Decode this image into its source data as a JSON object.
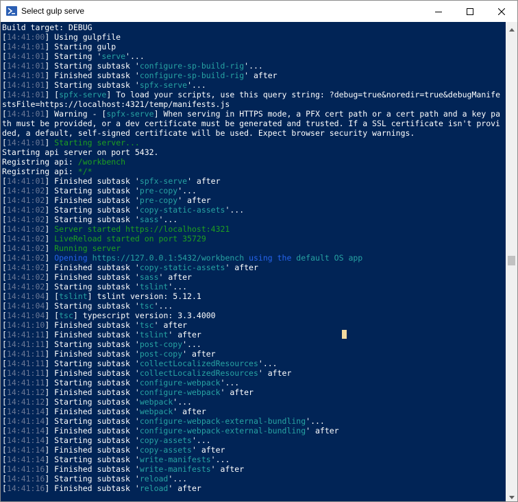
{
  "window": {
    "title": "Select gulp serve"
  },
  "icons": {
    "app": "powershell-icon",
    "minimize": "minimize-icon",
    "maximize": "maximize-icon",
    "close": "close-icon"
  },
  "colors": {
    "console_bg": "#012456",
    "cyan": "#27a3a3",
    "green": "#1ea020",
    "blue": "#2563eb"
  },
  "console": {
    "lines": [
      [
        {
          "t": "Build target: DEBUG",
          "c": ""
        }
      ],
      [
        {
          "t": "[",
          "c": ""
        },
        {
          "t": "14:41:00",
          "c": "ts"
        },
        {
          "t": "] Using gulpfile",
          "c": ""
        }
      ],
      [
        {
          "t": "[",
          "c": ""
        },
        {
          "t": "14:41:01",
          "c": "ts"
        },
        {
          "t": "] Starting gulp",
          "c": ""
        }
      ],
      [
        {
          "t": "[",
          "c": ""
        },
        {
          "t": "14:41:01",
          "c": "ts"
        },
        {
          "t": "] Starting '",
          "c": ""
        },
        {
          "t": "serve",
          "c": "cy"
        },
        {
          "t": "'...",
          "c": ""
        }
      ],
      [
        {
          "t": "[",
          "c": ""
        },
        {
          "t": "14:41:01",
          "c": "ts"
        },
        {
          "t": "] Starting subtask '",
          "c": ""
        },
        {
          "t": "configure-sp-build-rig",
          "c": "cy"
        },
        {
          "t": "'...",
          "c": ""
        }
      ],
      [
        {
          "t": "[",
          "c": ""
        },
        {
          "t": "14:41:01",
          "c": "ts"
        },
        {
          "t": "] Finished subtask '",
          "c": ""
        },
        {
          "t": "configure-sp-build-rig",
          "c": "cy"
        },
        {
          "t": "' after",
          "c": ""
        }
      ],
      [
        {
          "t": "[",
          "c": ""
        },
        {
          "t": "14:41:01",
          "c": "ts"
        },
        {
          "t": "] Starting subtask '",
          "c": ""
        },
        {
          "t": "spfx-serve",
          "c": "cy"
        },
        {
          "t": "'...",
          "c": ""
        }
      ],
      [
        {
          "t": "[",
          "c": ""
        },
        {
          "t": "14:41:01",
          "c": "ts"
        },
        {
          "t": "] [",
          "c": ""
        },
        {
          "t": "spfx-serve",
          "c": "cy"
        },
        {
          "t": "] To load your scripts, use this query string: ?debug=true&noredir=true&debugManife",
          "c": ""
        }
      ],
      [
        {
          "t": "stsFile=https://localhost:4321/temp/manifests.js",
          "c": ""
        }
      ],
      [
        {
          "t": "[",
          "c": ""
        },
        {
          "t": "14:41:01",
          "c": "ts"
        },
        {
          "t": "] Warning - [",
          "c": ""
        },
        {
          "t": "spfx-serve",
          "c": "cy"
        },
        {
          "t": "] When serving in HTTPS mode, a PFX cert path or a cert path and a key pa",
          "c": ""
        }
      ],
      [
        {
          "t": "th must be provided, or a dev certificate must be generated and trusted. If a SSL certificate isn't provi",
          "c": ""
        }
      ],
      [
        {
          "t": "ded, a default, self-signed certificate will be used. Expect browser security warnings.",
          "c": ""
        }
      ],
      [
        {
          "t": "[",
          "c": ""
        },
        {
          "t": "14:41:01",
          "c": "ts"
        },
        {
          "t": "] ",
          "c": ""
        },
        {
          "t": "Starting server...",
          "c": "gr"
        }
      ],
      [
        {
          "t": "Starting api server on port 5432.",
          "c": ""
        }
      ],
      [
        {
          "t": "Registring api: ",
          "c": ""
        },
        {
          "t": "/workbench",
          "c": "gr"
        }
      ],
      [
        {
          "t": "Registring api: ",
          "c": ""
        },
        {
          "t": "*/*",
          "c": "gr"
        }
      ],
      [
        {
          "t": "[",
          "c": ""
        },
        {
          "t": "14:41:01",
          "c": "ts"
        },
        {
          "t": "] Finished subtask '",
          "c": ""
        },
        {
          "t": "spfx-serve",
          "c": "cy"
        },
        {
          "t": "' after",
          "c": ""
        }
      ],
      [
        {
          "t": "[",
          "c": ""
        },
        {
          "t": "14:41:02",
          "c": "ts"
        },
        {
          "t": "] Starting subtask '",
          "c": ""
        },
        {
          "t": "pre-copy",
          "c": "cy"
        },
        {
          "t": "'...",
          "c": ""
        }
      ],
      [
        {
          "t": "[",
          "c": ""
        },
        {
          "t": "14:41:02",
          "c": "ts"
        },
        {
          "t": "] Finished subtask '",
          "c": ""
        },
        {
          "t": "pre-copy",
          "c": "cy"
        },
        {
          "t": "' after",
          "c": ""
        }
      ],
      [
        {
          "t": "[",
          "c": ""
        },
        {
          "t": "14:41:02",
          "c": "ts"
        },
        {
          "t": "] Starting subtask '",
          "c": ""
        },
        {
          "t": "copy-static-assets",
          "c": "cy"
        },
        {
          "t": "'...",
          "c": ""
        }
      ],
      [
        {
          "t": "[",
          "c": ""
        },
        {
          "t": "14:41:02",
          "c": "ts"
        },
        {
          "t": "] Starting subtask '",
          "c": ""
        },
        {
          "t": "sass",
          "c": "cy"
        },
        {
          "t": "'...",
          "c": ""
        }
      ],
      [
        {
          "t": "[",
          "c": ""
        },
        {
          "t": "14:41:02",
          "c": "ts"
        },
        {
          "t": "] ",
          "c": ""
        },
        {
          "t": "Server started https://localhost:4321",
          "c": "gr"
        }
      ],
      [
        {
          "t": "[",
          "c": ""
        },
        {
          "t": "14:41:02",
          "c": "ts"
        },
        {
          "t": "] ",
          "c": ""
        },
        {
          "t": "LiveReload started on port 35729",
          "c": "gr"
        }
      ],
      [
        {
          "t": "[",
          "c": ""
        },
        {
          "t": "14:41:02",
          "c": "ts"
        },
        {
          "t": "] ",
          "c": ""
        },
        {
          "t": "Running server",
          "c": "gr"
        }
      ],
      [
        {
          "t": "[",
          "c": ""
        },
        {
          "t": "14:41:02",
          "c": "ts"
        },
        {
          "t": "] ",
          "c": ""
        },
        {
          "t": "Opening",
          "c": "bl"
        },
        {
          "t": " https://127.0.0.1:5432/workbench ",
          "c": "cy"
        },
        {
          "t": "using the",
          "c": "bl"
        },
        {
          "t": " default OS app",
          "c": "cy"
        }
      ],
      [
        {
          "t": "[",
          "c": ""
        },
        {
          "t": "14:41:02",
          "c": "ts"
        },
        {
          "t": "] Finished subtask '",
          "c": ""
        },
        {
          "t": "copy-static-assets",
          "c": "cy"
        },
        {
          "t": "' after",
          "c": ""
        }
      ],
      [
        {
          "t": "[",
          "c": ""
        },
        {
          "t": "14:41:02",
          "c": "ts"
        },
        {
          "t": "] Finished subtask '",
          "c": ""
        },
        {
          "t": "sass",
          "c": "cy"
        },
        {
          "t": "' after",
          "c": ""
        }
      ],
      [
        {
          "t": "[",
          "c": ""
        },
        {
          "t": "14:41:02",
          "c": "ts"
        },
        {
          "t": "] Starting subtask '",
          "c": ""
        },
        {
          "t": "tslint",
          "c": "cy"
        },
        {
          "t": "'...",
          "c": ""
        }
      ],
      [
        {
          "t": "[",
          "c": ""
        },
        {
          "t": "14:41:04",
          "c": "ts"
        },
        {
          "t": "] [",
          "c": ""
        },
        {
          "t": "tslint",
          "c": "cy"
        },
        {
          "t": "] tslint version: 5.12.1",
          "c": ""
        }
      ],
      [
        {
          "t": "[",
          "c": ""
        },
        {
          "t": "14:41:04",
          "c": "ts"
        },
        {
          "t": "] Starting subtask '",
          "c": ""
        },
        {
          "t": "tsc",
          "c": "cy"
        },
        {
          "t": "'...",
          "c": ""
        }
      ],
      [
        {
          "t": "[",
          "c": ""
        },
        {
          "t": "14:41:04",
          "c": "ts"
        },
        {
          "t": "] [",
          "c": ""
        },
        {
          "t": "tsc",
          "c": "cy"
        },
        {
          "t": "] typescript version: 3.3.4000",
          "c": ""
        }
      ],
      [
        {
          "t": "[",
          "c": ""
        },
        {
          "t": "14:41:10",
          "c": "ts"
        },
        {
          "t": "] Finished subtask '",
          "c": ""
        },
        {
          "t": "tsc",
          "c": "cy"
        },
        {
          "t": "' after",
          "c": ""
        }
      ],
      [
        {
          "t": "[",
          "c": ""
        },
        {
          "t": "14:41:11",
          "c": "ts"
        },
        {
          "t": "] Finished subtask '",
          "c": ""
        },
        {
          "t": "tslint",
          "c": "cy"
        },
        {
          "t": "' after",
          "c": ""
        }
      ],
      [
        {
          "t": "[",
          "c": ""
        },
        {
          "t": "14:41:11",
          "c": "ts"
        },
        {
          "t": "] Starting subtask '",
          "c": ""
        },
        {
          "t": "post-copy",
          "c": "cy"
        },
        {
          "t": "'...",
          "c": ""
        }
      ],
      [
        {
          "t": "[",
          "c": ""
        },
        {
          "t": "14:41:11",
          "c": "ts"
        },
        {
          "t": "] Finished subtask '",
          "c": ""
        },
        {
          "t": "post-copy",
          "c": "cy"
        },
        {
          "t": "' after",
          "c": ""
        }
      ],
      [
        {
          "t": "[",
          "c": ""
        },
        {
          "t": "14:41:11",
          "c": "ts"
        },
        {
          "t": "] Starting subtask '",
          "c": ""
        },
        {
          "t": "collectLocalizedResources",
          "c": "cy"
        },
        {
          "t": "'...",
          "c": ""
        }
      ],
      [
        {
          "t": "[",
          "c": ""
        },
        {
          "t": "14:41:11",
          "c": "ts"
        },
        {
          "t": "] Finished subtask '",
          "c": ""
        },
        {
          "t": "collectLocalizedResources",
          "c": "cy"
        },
        {
          "t": "' after",
          "c": ""
        }
      ],
      [
        {
          "t": "[",
          "c": ""
        },
        {
          "t": "14:41:11",
          "c": "ts"
        },
        {
          "t": "] Starting subtask '",
          "c": ""
        },
        {
          "t": "configure-webpack",
          "c": "cy"
        },
        {
          "t": "'...",
          "c": ""
        }
      ],
      [
        {
          "t": "[",
          "c": ""
        },
        {
          "t": "14:41:12",
          "c": "ts"
        },
        {
          "t": "] Finished subtask '",
          "c": ""
        },
        {
          "t": "configure-webpack",
          "c": "cy"
        },
        {
          "t": "' after",
          "c": ""
        }
      ],
      [
        {
          "t": "[",
          "c": ""
        },
        {
          "t": "14:41:12",
          "c": "ts"
        },
        {
          "t": "] Starting subtask '",
          "c": ""
        },
        {
          "t": "webpack",
          "c": "cy"
        },
        {
          "t": "'...",
          "c": ""
        }
      ],
      [
        {
          "t": "[",
          "c": ""
        },
        {
          "t": "14:41:14",
          "c": "ts"
        },
        {
          "t": "] Finished subtask '",
          "c": ""
        },
        {
          "t": "webpack",
          "c": "cy"
        },
        {
          "t": "' after",
          "c": ""
        }
      ],
      [
        {
          "t": "[",
          "c": ""
        },
        {
          "t": "14:41:14",
          "c": "ts"
        },
        {
          "t": "] Starting subtask '",
          "c": ""
        },
        {
          "t": "configure-webpack-external-bundling",
          "c": "cy"
        },
        {
          "t": "'...",
          "c": ""
        }
      ],
      [
        {
          "t": "[",
          "c": ""
        },
        {
          "t": "14:41:14",
          "c": "ts"
        },
        {
          "t": "] Finished subtask '",
          "c": ""
        },
        {
          "t": "configure-webpack-external-bundling",
          "c": "cy"
        },
        {
          "t": "' after",
          "c": ""
        }
      ],
      [
        {
          "t": "[",
          "c": ""
        },
        {
          "t": "14:41:14",
          "c": "ts"
        },
        {
          "t": "] Starting subtask '",
          "c": ""
        },
        {
          "t": "copy-assets",
          "c": "cy"
        },
        {
          "t": "'...",
          "c": ""
        }
      ],
      [
        {
          "t": "[",
          "c": ""
        },
        {
          "t": "14:41:14",
          "c": "ts"
        },
        {
          "t": "] Finished subtask '",
          "c": ""
        },
        {
          "t": "copy-assets",
          "c": "cy"
        },
        {
          "t": "' after",
          "c": ""
        }
      ],
      [
        {
          "t": "[",
          "c": ""
        },
        {
          "t": "14:41:14",
          "c": "ts"
        },
        {
          "t": "] Starting subtask '",
          "c": ""
        },
        {
          "t": "write-manifests",
          "c": "cy"
        },
        {
          "t": "'...",
          "c": ""
        }
      ],
      [
        {
          "t": "[",
          "c": ""
        },
        {
          "t": "14:41:16",
          "c": "ts"
        },
        {
          "t": "] Finished subtask '",
          "c": ""
        },
        {
          "t": "write-manifests",
          "c": "cy"
        },
        {
          "t": "' after",
          "c": ""
        }
      ],
      [
        {
          "t": "[",
          "c": ""
        },
        {
          "t": "14:41:16",
          "c": "ts"
        },
        {
          "t": "] Starting subtask '",
          "c": ""
        },
        {
          "t": "reload",
          "c": "cy"
        },
        {
          "t": "'...",
          "c": ""
        }
      ],
      [
        {
          "t": "[",
          "c": ""
        },
        {
          "t": "14:41:16",
          "c": "ts"
        },
        {
          "t": "] Finished subtask '",
          "c": ""
        },
        {
          "t": "reload",
          "c": "cy"
        },
        {
          "t": "' after",
          "c": ""
        }
      ]
    ]
  }
}
